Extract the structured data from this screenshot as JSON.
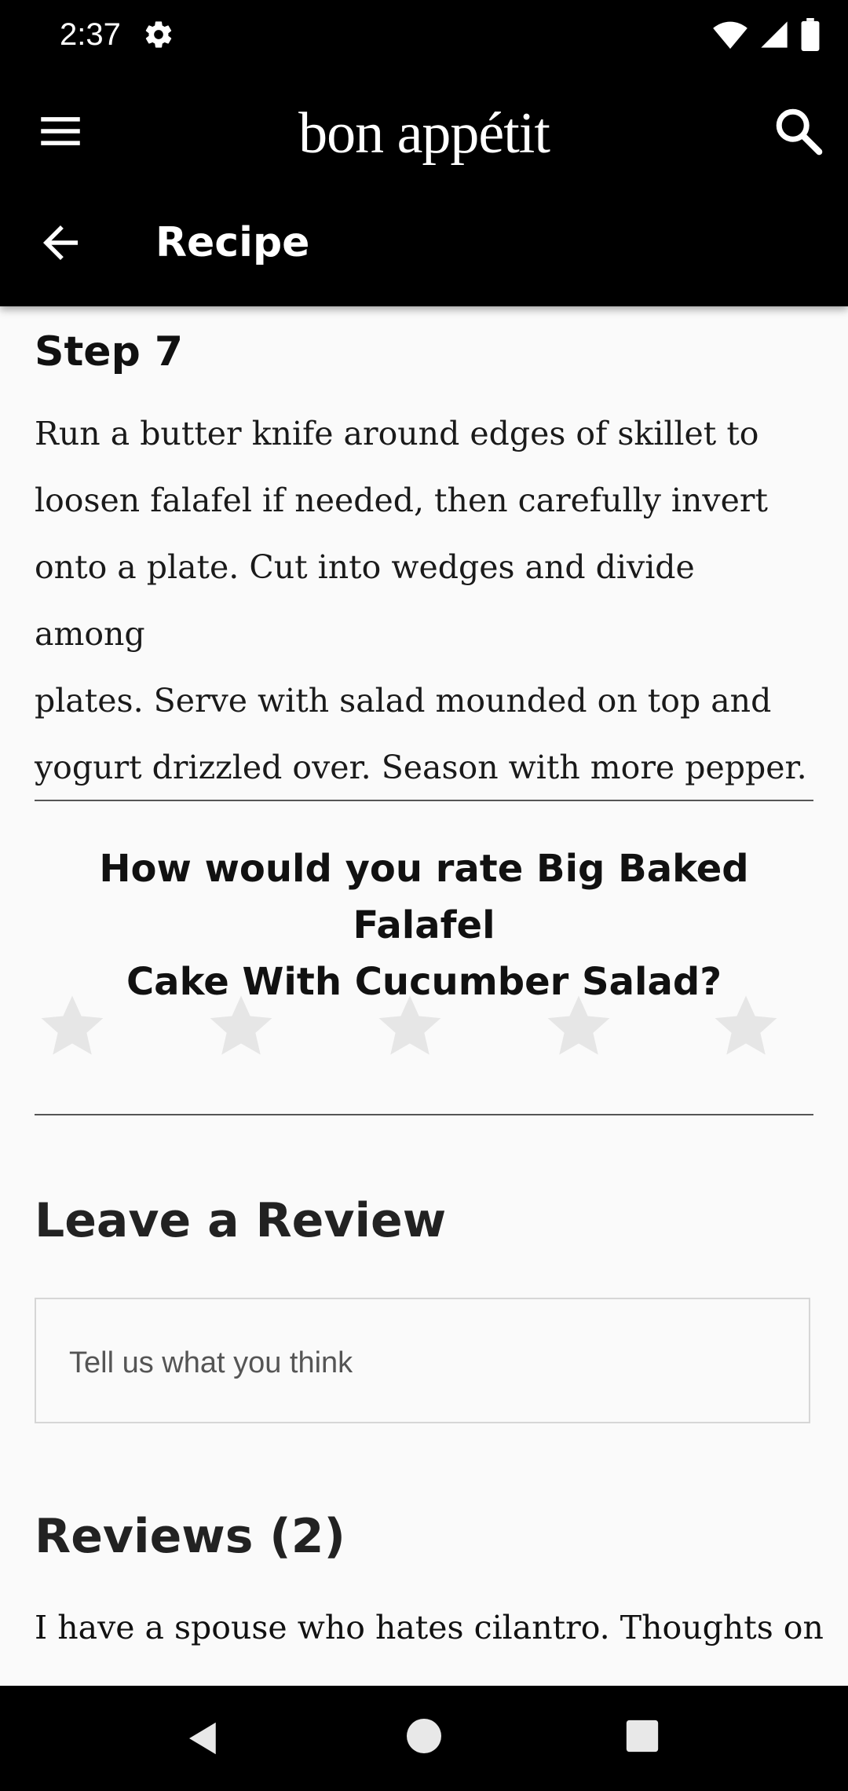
{
  "status_bar": {
    "time": "2:37",
    "icons": [
      "gear-icon",
      "wifi-icon",
      "signal-icon",
      "battery-icon"
    ]
  },
  "app_bar": {
    "brand": "bon appétit",
    "title": "Recipe",
    "icons": [
      "menu-icon",
      "search-icon",
      "back-arrow-icon"
    ]
  },
  "step": {
    "title": "Step 7",
    "lines": [
      "Run a butter knife around edges of skillet to",
      "loosen falafel if needed, then carefully invert",
      "onto a plate. Cut into wedges and divide among",
      "plates. Serve with salad mounded on top and",
      "yogurt drizzled over. Season with more pepper."
    ]
  },
  "rating": {
    "question_line1": "How would you rate Big Baked Falafel",
    "question_line2": "Cake With Cucumber Salad?",
    "max_stars": 5,
    "selected": 0,
    "star_color": "#e6e6e6"
  },
  "review_form": {
    "heading": "Leave a Review",
    "placeholder": "Tell us what you think"
  },
  "reviews": {
    "heading": "Reviews (2)",
    "first_snippet": "I have a spouse who hates cilantro. Thoughts on"
  },
  "nav_bar": {
    "icons": [
      "back-triangle-icon",
      "home-circle-icon",
      "recents-square-icon"
    ]
  },
  "colors": {
    "header_bg": "#000000",
    "page_bg": "#fafafa",
    "divider": "#555555"
  }
}
